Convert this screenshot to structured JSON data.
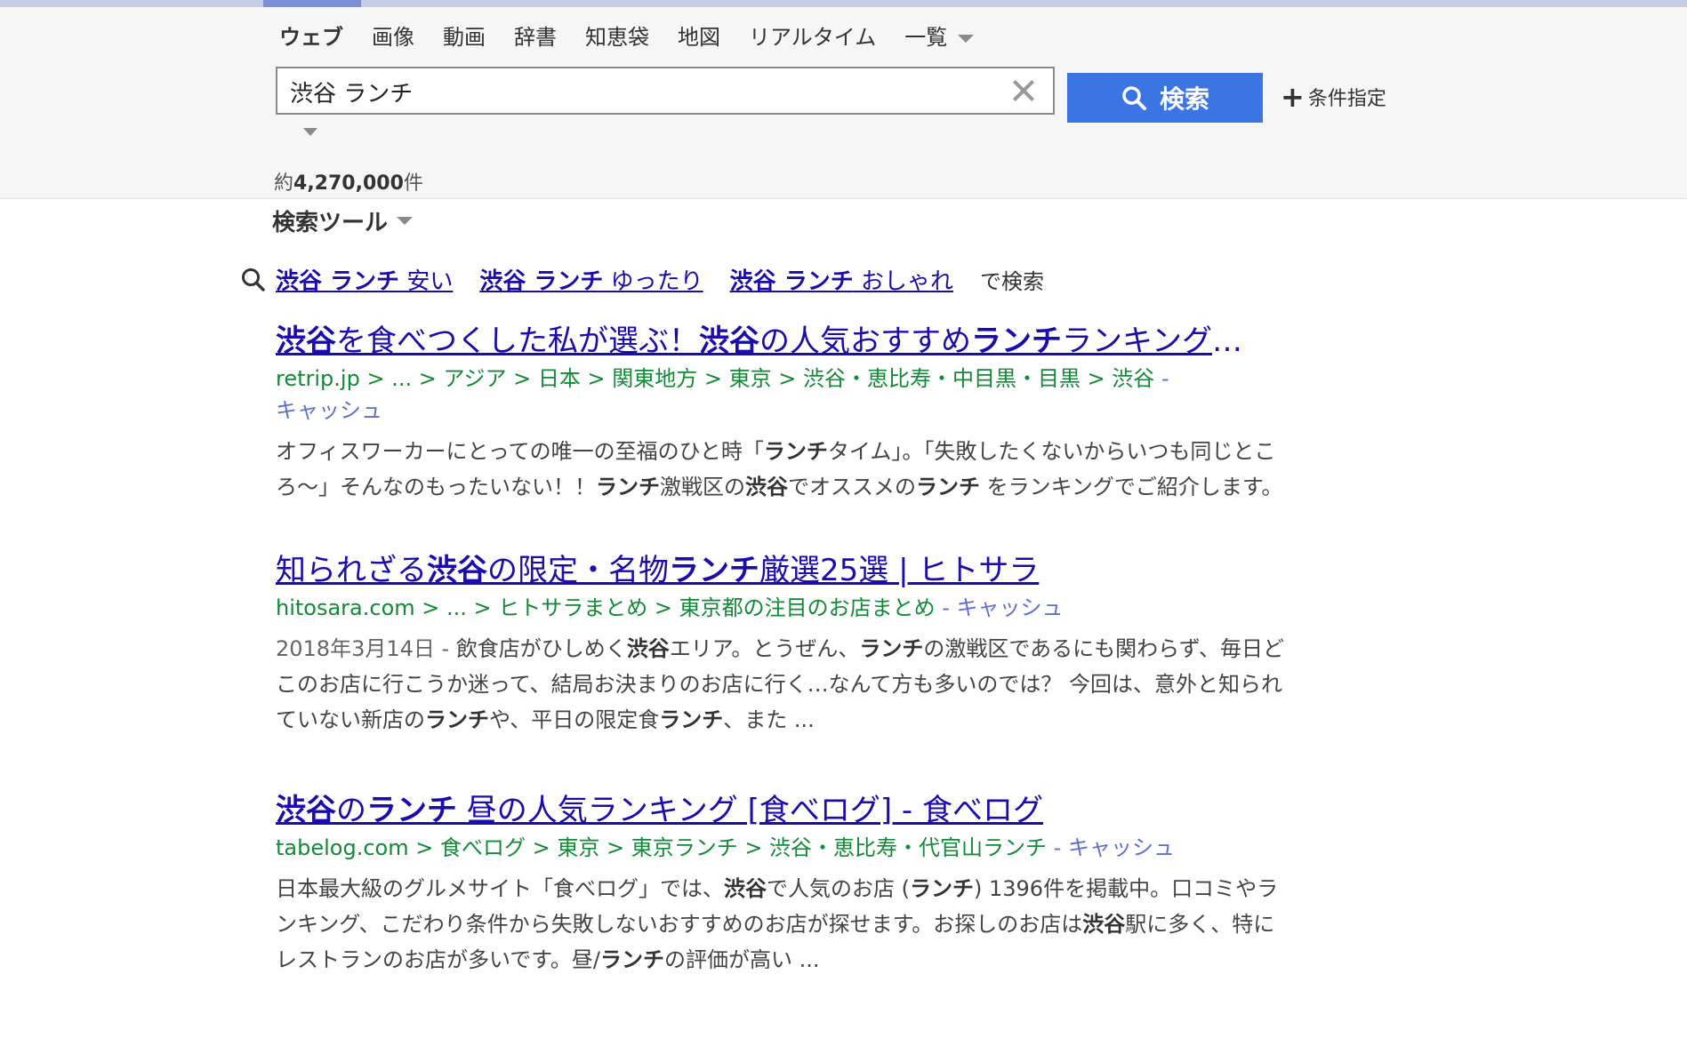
{
  "nav": {
    "items": [
      "ウェブ",
      "画像",
      "動画",
      "辞書",
      "知恵袋",
      "地図",
      "リアルタイム",
      "一覧"
    ]
  },
  "search": {
    "query": "渋谷 ランチ",
    "button_label": "検索",
    "conditions_label": "条件指定"
  },
  "result_count": {
    "prefix": "約",
    "number": "4,270,000",
    "suffix": "件"
  },
  "tools_label": "検索ツール",
  "suggestions": {
    "items": [
      {
        "bold": "渋谷 ランチ",
        "rest": " 安い"
      },
      {
        "bold": "渋谷 ランチ",
        "rest": " ゆったり"
      },
      {
        "bold": "渋谷 ランチ",
        "rest": " おしゃれ"
      }
    ],
    "tail": "で検索"
  },
  "results": [
    {
      "title": [
        {
          "t": "渋谷",
          "b": true
        },
        {
          "t": "を食べつくした私が選ぶ！",
          "b": false
        },
        {
          "t": "渋谷",
          "b": true
        },
        {
          "t": "の人気おすすめ",
          "b": false
        },
        {
          "t": "ランチ",
          "b": true
        },
        {
          "t": "ランキング！…",
          "b": false
        }
      ],
      "url": "retrip.jp > ... > アジア > 日本 > 関東地方 > 東京 > 渋谷・恵比寿・中目黒・目黒 > 渋谷",
      "cache": " - キャッシュ",
      "date": "",
      "snippet": [
        {
          "t": "オフィスワーカーにとっての唯一の至福のひと時「",
          "b": false
        },
        {
          "t": "ランチ",
          "b": true
        },
        {
          "t": "タイム」。「失敗したくないからいつも同じところ〜」そんなのもったいない！！",
          "b": false
        },
        {
          "t": "ランチ",
          "b": true
        },
        {
          "t": "激戦区の",
          "b": false
        },
        {
          "t": "渋谷",
          "b": true
        },
        {
          "t": "でオススメの",
          "b": false
        },
        {
          "t": "ランチ",
          "b": true
        },
        {
          "t": " をランキングでご紹介します。",
          "b": false
        }
      ]
    },
    {
      "title": [
        {
          "t": "知られざる",
          "b": false
        },
        {
          "t": "渋谷",
          "b": true
        },
        {
          "t": "の限定・名物",
          "b": false
        },
        {
          "t": "ランチ",
          "b": true
        },
        {
          "t": "厳選25選 | ヒトサラ",
          "b": false
        }
      ],
      "url": "hitosara.com > ... > ヒトサラまとめ > 東京都の注目のお店まとめ",
      "cache": " - キャッシュ",
      "date": "2018年3月14日 - ",
      "snippet": [
        {
          "t": "飲食店がひしめく",
          "b": false
        },
        {
          "t": "渋谷",
          "b": true
        },
        {
          "t": "エリア。とうぜん、",
          "b": false
        },
        {
          "t": "ランチ",
          "b": true
        },
        {
          "t": "の激戦区であるにも関わらず、毎日どこのお店に行こうか迷って、結局お決まりのお店に行く…なんて方も多いのでは？ 今回は、意外と知られていない新店の",
          "b": false
        },
        {
          "t": "ランチ",
          "b": true
        },
        {
          "t": "や、平日の限定食",
          "b": false
        },
        {
          "t": "ランチ",
          "b": true
        },
        {
          "t": "、また ...",
          "b": false
        }
      ]
    },
    {
      "title": [
        {
          "t": "渋谷",
          "b": true
        },
        {
          "t": "の",
          "b": false
        },
        {
          "t": "ランチ",
          "b": true
        },
        {
          "t": " 昼の人気ランキング [食べログ] - 食べログ",
          "b": false
        }
      ],
      "url": "tabelog.com > 食べログ > 東京 > 東京ランチ > 渋谷・恵比寿・代官山ランチ",
      "cache": " - キャッシュ",
      "date": "",
      "snippet": [
        {
          "t": "日本最大級のグルメサイト「食べログ」では、",
          "b": false
        },
        {
          "t": "渋谷",
          "b": true
        },
        {
          "t": "で人気のお店 (",
          "b": false
        },
        {
          "t": "ランチ",
          "b": true
        },
        {
          "t": ") 1396件を掲載中。口コミやランキング、こだわり条件から失敗しないおすすめのお店が探せます。お探しのお店は",
          "b": false
        },
        {
          "t": "渋谷",
          "b": true
        },
        {
          "t": "駅に多く、特にレストランのお店が多いです。昼/",
          "b": false
        },
        {
          "t": "ランチ",
          "b": true
        },
        {
          "t": "の評価が高い ...",
          "b": false
        }
      ]
    }
  ]
}
